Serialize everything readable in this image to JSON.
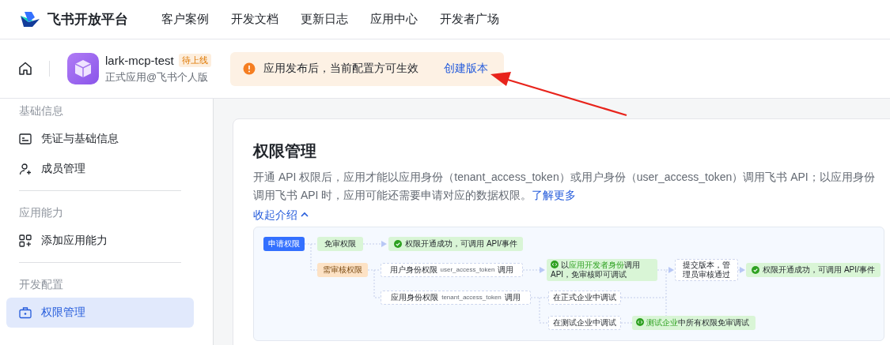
{
  "top_nav": {
    "brand": "飞书开放平台",
    "links": [
      "客户案例",
      "开发文档",
      "更新日志",
      "应用中心",
      "开发者广场"
    ]
  },
  "app_header": {
    "app_name": "lark-mcp-test",
    "status_badge": "待上线",
    "app_type": "正式应用@飞书个人版"
  },
  "notice": {
    "message": "应用发布后，当前配置方可生效",
    "action": "创建版本"
  },
  "sidebar": {
    "sections": [
      {
        "heading": "基础信息",
        "items": [
          {
            "label": "凭证与基础信息",
            "kind": "credentials",
            "selected": false
          },
          {
            "label": "成员管理",
            "kind": "members",
            "selected": false
          }
        ]
      },
      {
        "heading": "应用能力",
        "items": [
          {
            "label": "添加应用能力",
            "kind": "capability",
            "selected": false
          }
        ]
      },
      {
        "heading": "开发配置",
        "items": [
          {
            "label": "权限管理",
            "kind": "permission",
            "selected": true
          }
        ]
      }
    ]
  },
  "page": {
    "title": "权限管理",
    "description": "开通 API 权限后，应用才能以应用身份（tenant_access_token）或用户身份（user_access_token）调用飞书 API；以应用身份调用飞书 API 时，应用可能还需要申请对应的数据权限。",
    "learn_more": "了解更多",
    "collapse": "收起介绍",
    "flow": [
      {
        "kind": "primary",
        "text": "申请权限"
      },
      {
        "kind": "free",
        "text": "免审权限"
      },
      {
        "kind": "success",
        "text": "权限开通成功，可调用 API/事件"
      },
      {
        "kind": "review",
        "text": "需审核权限"
      },
      {
        "kind": "token",
        "text": "用户身份权限",
        "token": "user_access_token",
        "suffix": "调用"
      },
      {
        "kind": "debug",
        "parts": [
          {
            "text": "以",
            "highlight": false
          },
          {
            "text": "应用开发者身份",
            "highlight": true
          },
          {
            "text": "调用 API，免审核即可调试",
            "highlight": false
          }
        ]
      },
      {
        "kind": "step",
        "text": "提交版本，管理员审核通过"
      },
      {
        "kind": "success",
        "text": "权限开通成功，可调用 API/事件"
      },
      {
        "kind": "token",
        "text": "应用身份权限",
        "token": "tenant_access_token",
        "suffix": "调用"
      },
      {
        "kind": "step",
        "text": "在正式企业中调试"
      },
      {
        "kind": "step",
        "text": "在测试企业中调试"
      },
      {
        "kind": "debug",
        "parts": [
          {
            "text": "测试企业",
            "highlight": true
          },
          {
            "text": "中所有权限免审调试",
            "highlight": false
          }
        ]
      }
    ]
  }
}
